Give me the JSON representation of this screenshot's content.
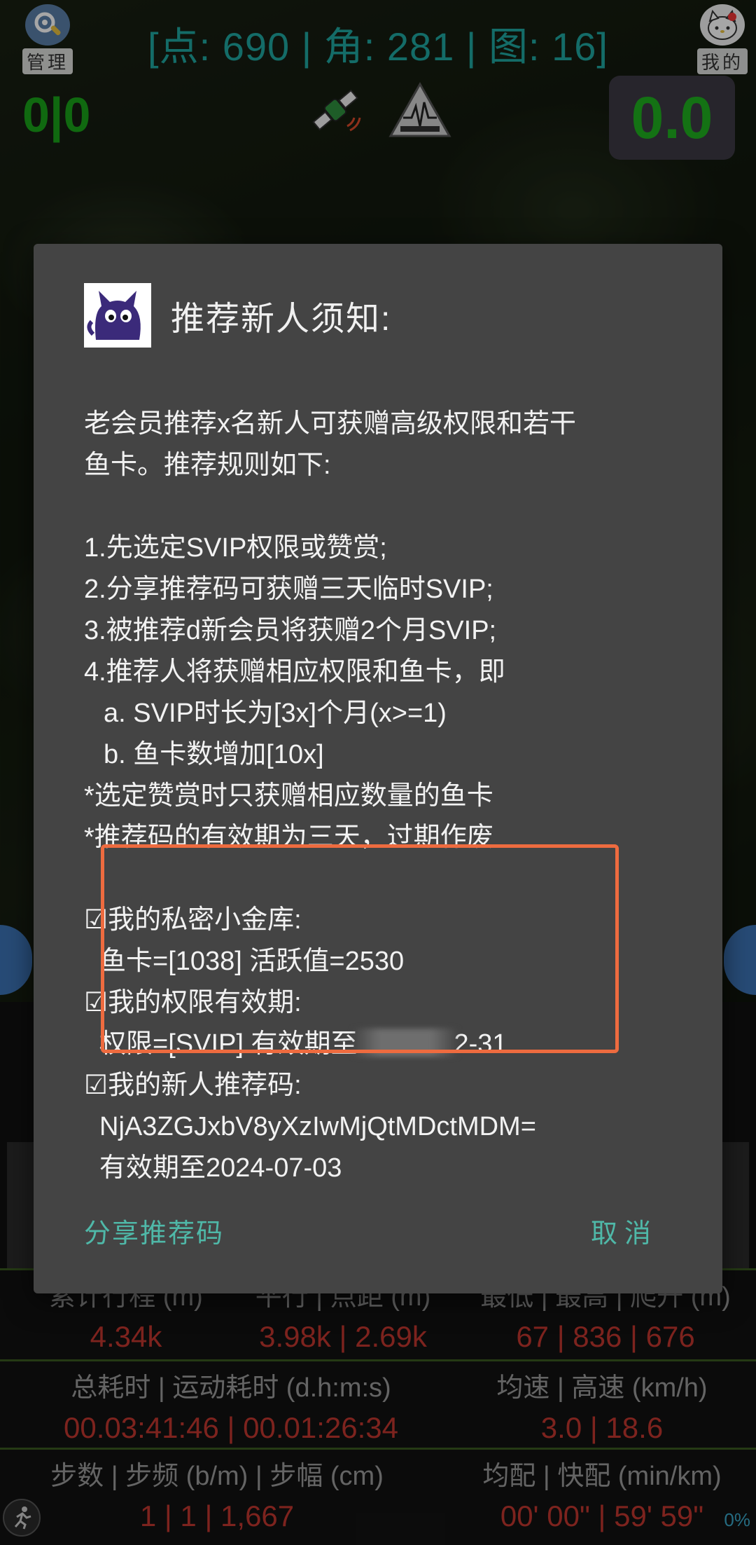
{
  "topbar": {
    "left_button_label": "管理",
    "right_button_label": "我的",
    "stats_text": "[点: 690 | 角: 281 | 图: 16]",
    "counter_left": "0|0",
    "speed_value": "0.0"
  },
  "dialog": {
    "title": "推荐新人须知:",
    "intro_lines": [
      "老会员推荐x名新人可获赠高级权限和若干",
      "鱼卡。推荐规则如下:"
    ],
    "rules": [
      "1.先选定SVIP权限或赞赏;",
      "2.分享推荐码可获赠三天临时SVIP;",
      "3.被推荐d新会员将获赠2个月SVIP;",
      "4.推荐人将获赠相应权限和鱼卡，即"
    ],
    "subrules": [
      "a. SVIP时长为[3x]个月(x>=1)",
      "b. 鱼卡数增加[10x]"
    ],
    "notes": [
      "*选定赞赏时只获赠相应数量的鱼卡",
      "*推荐码的有效期为三天，过期作废"
    ],
    "vault_heading": "☑我的私密小金库:",
    "vault_values": "鱼卡=[1038]   活跃值=2530",
    "permission_heading": "☑我的权限有效期:",
    "permission_prefix": "权限=[SVIP]   有效期至",
    "permission_suffix": "2-31",
    "code_heading": "☑我的新人推荐码:",
    "code_value": "NjA3ZGJxbV8yXzIwMjQtMDctMDM=",
    "code_expiry": "有效期至2024-07-03",
    "share_button": "分享推荐码",
    "cancel_button": "取消"
  },
  "stats": {
    "row0": [
      {
        "label": "累计行程 (m)",
        "value": "4.34k"
      },
      {
        "label": "平行 | 点距 (m)",
        "value": "3.98k | 2.69k"
      },
      {
        "label": "最低 | 最高 | 爬升 (m)",
        "value": "67 | 836 | 676"
      }
    ],
    "row1": [
      {
        "label": "总耗时 | 运动耗时 (d.h:m:s)",
        "value": "00.03:41:46 | 00.01:26:34"
      },
      {
        "label": "均速 | 高速 (km/h)",
        "value": "3.0 | 18.6"
      }
    ],
    "row2": [
      {
        "label": "步数 | 步频 (b/m) | 步幅 (cm)",
        "value": "1 | 1 | 1,667"
      },
      {
        "label": "均配 | 快配 (min/km)",
        "value": "00' 00\" | 59' 59\""
      }
    ],
    "percent": "0%"
  },
  "colors": {
    "accent_teal": "#4fb8a8",
    "highlight_orange": "#ee6b3f",
    "value_red": "#c0372f",
    "counter_green": "#1aa11a"
  },
  "icons": {
    "left": "gear-wrench-icon",
    "right": "hello-kitty-avatar-icon",
    "satellite": "satellite-icon",
    "quake": "earthquake-warning-icon",
    "logo": "black-cat-logo-icon",
    "runner": "runner-icon"
  }
}
